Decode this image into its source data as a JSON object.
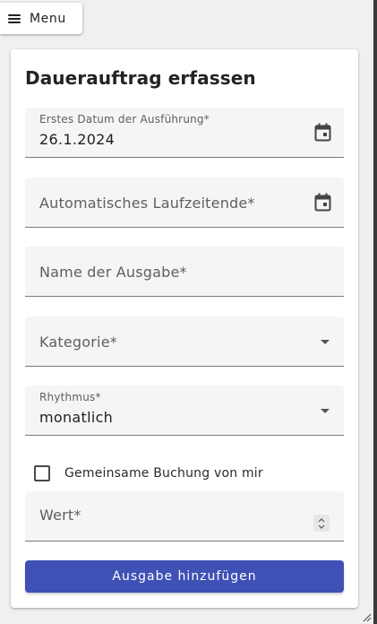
{
  "menu": {
    "label": "Menu",
    "icon": "hamburger-icon"
  },
  "form": {
    "title": "Dauerauftrag erfassen",
    "first_date": {
      "label": "Erstes Datum der Ausführung*",
      "value": "26.1.2024",
      "icon": "calendar-icon"
    },
    "end_date": {
      "label": "Automatisches Laufzeitende*",
      "icon": "calendar-icon"
    },
    "name": {
      "label": "Name der Ausgabe*"
    },
    "category": {
      "label": "Kategorie*",
      "icon": "dropdown-arrow-icon"
    },
    "rhythm": {
      "label": "Rhythmus*",
      "value": "monatlich",
      "icon": "dropdown-arrow-icon"
    },
    "shared": {
      "label": "Gemeinsame Buchung von mir",
      "checked": false
    },
    "amount": {
      "label": "Wert*",
      "icon": "number-spinner-icon"
    },
    "submit_label": "Ausgabe hinzufügen"
  },
  "colors": {
    "accent": "#3f51b5",
    "field_bg": "#f5f5f5",
    "page_bg": "#f0f0f0"
  }
}
